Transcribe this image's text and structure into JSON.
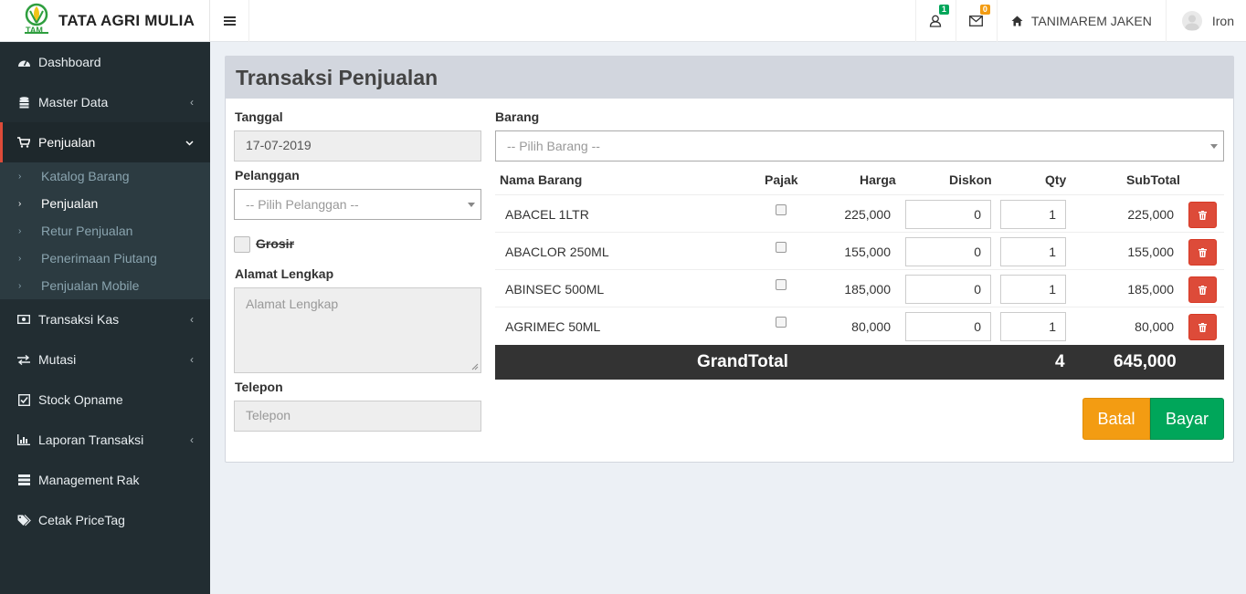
{
  "header": {
    "brand": "TATA AGRI MULIA",
    "logo_text": "TAM",
    "notif_user_count": "1",
    "notif_mail_count": "0",
    "store_name": "TANIMAREM JAKEN",
    "user_name": "Iron"
  },
  "colors": {
    "sidebar_bg": "#222d32",
    "accent_red": "#dd4b39",
    "orange": "#f39c12",
    "green": "#00a65a"
  },
  "sidebar": {
    "items": [
      {
        "label": "Dashboard",
        "icon": "dashboard-icon"
      },
      {
        "label": "Master Data",
        "icon": "database-icon"
      },
      {
        "label": "Penjualan",
        "icon": "cart-icon"
      },
      {
        "label": "Transaksi Kas",
        "icon": "money-icon"
      },
      {
        "label": "Mutasi",
        "icon": "exchange-icon"
      },
      {
        "label": "Stock Opname",
        "icon": "check-square-icon"
      },
      {
        "label": "Laporan Transaksi",
        "icon": "bar-chart-icon"
      },
      {
        "label": "Management Rak",
        "icon": "server-icon"
      },
      {
        "label": "Cetak PriceTag",
        "icon": "tags-icon"
      }
    ],
    "submenu": [
      {
        "label": "Katalog Barang"
      },
      {
        "label": "Penjualan"
      },
      {
        "label": "Retur Penjualan"
      },
      {
        "label": "Penerimaan Piutang"
      },
      {
        "label": "Penjualan Mobile"
      }
    ]
  },
  "page": {
    "title": "Transaksi Penjualan"
  },
  "form": {
    "tanggal_label": "Tanggal",
    "tanggal_value": "17-07-2019",
    "pelanggan_label": "Pelanggan",
    "pelanggan_placeholder": "-- Pilih Pelanggan --",
    "grosir_label": "Grosir",
    "alamat_label": "Alamat Lengkap",
    "alamat_placeholder": "Alamat Lengkap",
    "telepon_label": "Telepon",
    "telepon_placeholder": "Telepon",
    "barang_label": "Barang",
    "barang_placeholder": "-- Pilih Barang --"
  },
  "table": {
    "headers": {
      "nama": "Nama Barang",
      "pajak": "Pajak",
      "harga": "Harga",
      "diskon": "Diskon",
      "qty": "Qty",
      "subtotal": "SubTotal"
    },
    "rows": [
      {
        "nama": "ABACEL 1LTR",
        "harga": "225,000",
        "diskon": "0",
        "qty": "1",
        "subtotal": "225,000"
      },
      {
        "nama": "ABACLOR 250ML",
        "harga": "155,000",
        "diskon": "0",
        "qty": "1",
        "subtotal": "155,000"
      },
      {
        "nama": "ABINSEC 500ML",
        "harga": "185,000",
        "diskon": "0",
        "qty": "1",
        "subtotal": "185,000"
      },
      {
        "nama": "AGRIMEC 50ML",
        "harga": "80,000",
        "diskon": "0",
        "qty": "1",
        "subtotal": "80,000"
      }
    ],
    "grand_label": "GrandTotal",
    "grand_qty": "4",
    "grand_total": "645,000"
  },
  "actions": {
    "batal": "Batal",
    "bayar": "Bayar"
  }
}
